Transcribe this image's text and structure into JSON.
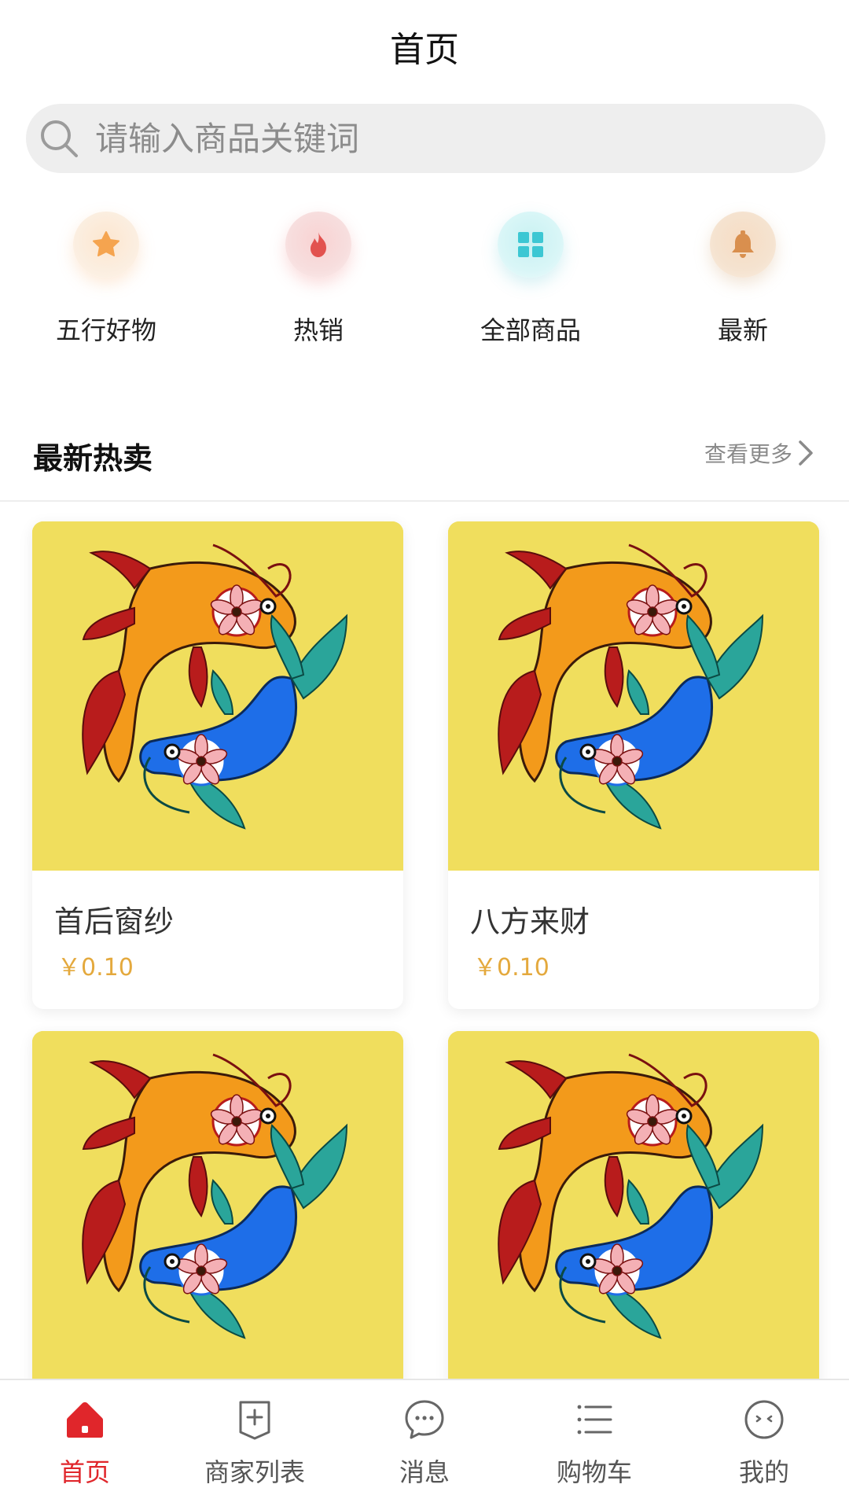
{
  "header": {
    "title": "首页"
  },
  "search": {
    "placeholder": "请输入商品关键词",
    "value": ""
  },
  "categories": [
    {
      "label": "五行好物",
      "icon": "star-icon",
      "color": "#f5a44f"
    },
    {
      "label": "热销",
      "icon": "fire-icon",
      "color": "#e2524f"
    },
    {
      "label": "全部商品",
      "icon": "grid-icon",
      "color": "#3cc7d3"
    },
    {
      "label": "最新",
      "icon": "bell-icon",
      "color": "#d98f4e"
    }
  ],
  "section": {
    "title": "最新热卖",
    "more_label": "查看更多"
  },
  "products": [
    {
      "name": "首后窗纱",
      "price": "￥0.10",
      "image": "koi-fish-image"
    },
    {
      "name": "八方来财",
      "price": "￥0.10",
      "image": "koi-fish-image"
    },
    {
      "name": "",
      "price": "",
      "image": "koi-fish-image"
    },
    {
      "name": "",
      "price": "",
      "image": "koi-fish-image"
    }
  ],
  "tabbar": {
    "active": "首页",
    "items": [
      {
        "label": "首页",
        "icon": "home-icon"
      },
      {
        "label": "商家列表",
        "icon": "shop-list-icon"
      },
      {
        "label": "消息",
        "icon": "message-icon"
      },
      {
        "label": "购物车",
        "icon": "cart-list-icon"
      },
      {
        "label": "我的",
        "icon": "profile-icon"
      }
    ]
  },
  "colors": {
    "accent": "#e0262b",
    "price": "#e4a93d",
    "product_bg": "#f0de5d"
  }
}
